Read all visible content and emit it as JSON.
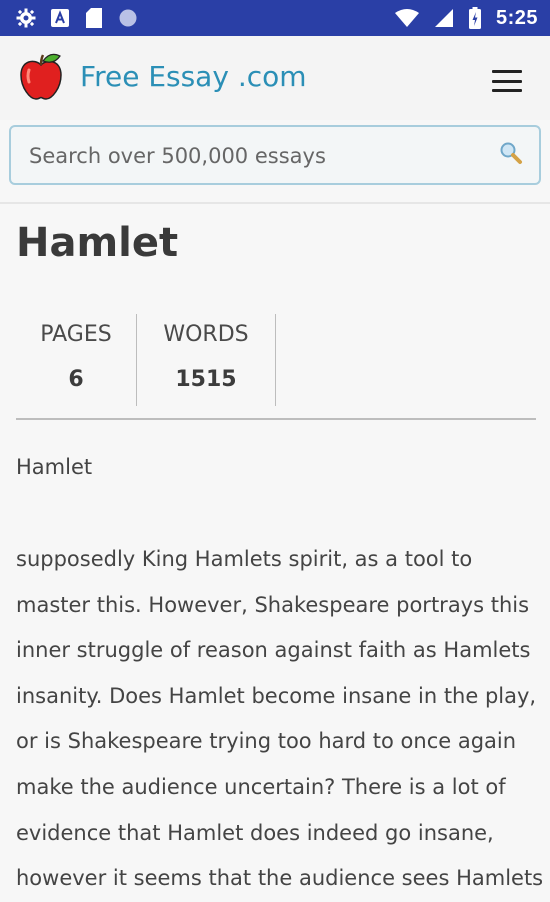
{
  "status_bar": {
    "time": "5:25",
    "left_icons": [
      "gear-icon",
      "a-icon",
      "sd-card-icon",
      "circle-icon"
    ],
    "right_icons": [
      "wifi-icon",
      "signal-icon",
      "battery-icon"
    ]
  },
  "header": {
    "brand": "Free Essay .com",
    "logo": "apple-logo",
    "menu_icon": "hamburger-menu-icon"
  },
  "search": {
    "placeholder": "Search over 500,000 essays",
    "icon": "search-icon"
  },
  "essay": {
    "title": "Hamlet",
    "stats": {
      "pages_label": "PAGES",
      "pages_value": "6",
      "words_label": "WORDS",
      "words_value": "1515"
    },
    "heading": "Hamlet",
    "body": "supposedly King Hamlets spirit, as a tool to\nmaster this.  However, Shakespeare portrays this\ninner struggle of reason against faith as Hamlets\ninsanity.  Does Hamlet become insane in the play,\nor is Shakespeare trying too hard to once again\nmake the audience uncertain?  There is a lot of\nevidence that Hamlet does indeed go insane,\nhowever it seems that the audience sees Hamlets"
  },
  "colors": {
    "status_bar": "#2a3fa6",
    "brand": "#2b8fb6",
    "search_border": "#a8cddd",
    "text": "#444444"
  }
}
